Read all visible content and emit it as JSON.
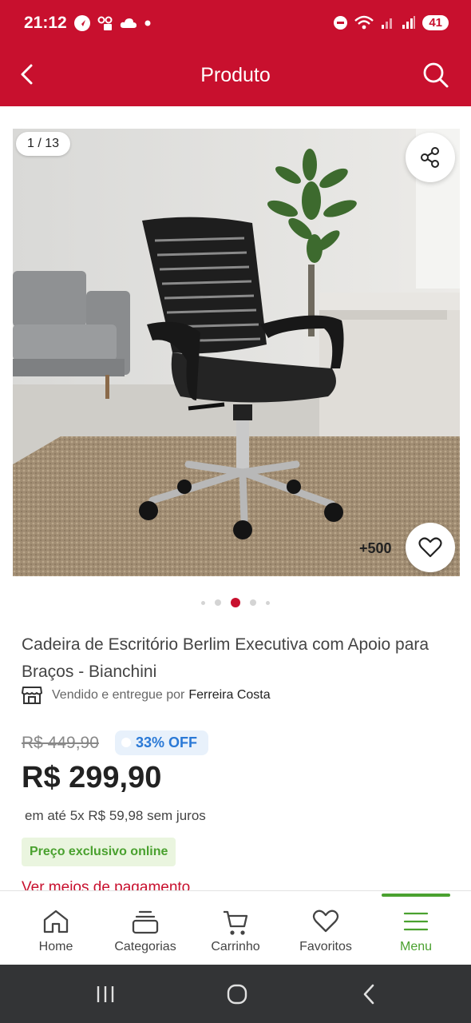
{
  "status_bar": {
    "time": "21:12",
    "battery": "41",
    "left_icons": [
      "navigation-icon",
      "voice-mail-icon",
      "cloud-icon",
      "dot-icon"
    ],
    "right_icons": [
      "do-not-disturb-icon",
      "wifi-icon",
      "signal-icon",
      "signal-icon"
    ]
  },
  "header": {
    "title": "Produto",
    "background": "#c8102e"
  },
  "gallery": {
    "counter": "1 / 13",
    "more_count": "+500",
    "active_dot": 3,
    "dot_count": 5
  },
  "product": {
    "title": "Cadeira de Escritório Berlim Executiva com Apoio para Braços - Bianchini",
    "seller_prefix": "Vendido e entregue por",
    "seller_name": "Ferreira Costa",
    "old_price": "R$ 449,90",
    "discount": "33% OFF",
    "price": "R$ 299,90",
    "installments": "em até 5x R$ 59,98 sem juros",
    "exclusive_label": "Preço exclusivo online",
    "payment_link": "Ver meios de pagamento"
  },
  "bottom_nav": {
    "items": [
      {
        "label": "Home",
        "icon": "home-icon"
      },
      {
        "label": "Categorias",
        "icon": "categories-icon"
      },
      {
        "label": "Carrinho",
        "icon": "cart-icon"
      },
      {
        "label": "Favoritos",
        "icon": "heart-icon"
      },
      {
        "label": "Menu",
        "icon": "menu-icon",
        "active": true
      }
    ],
    "active_color": "#4aa12f"
  },
  "colors": {
    "brand": "#c8102e",
    "discount_blue": "#2a79d6",
    "exclusive_green": "#4aa12f"
  }
}
